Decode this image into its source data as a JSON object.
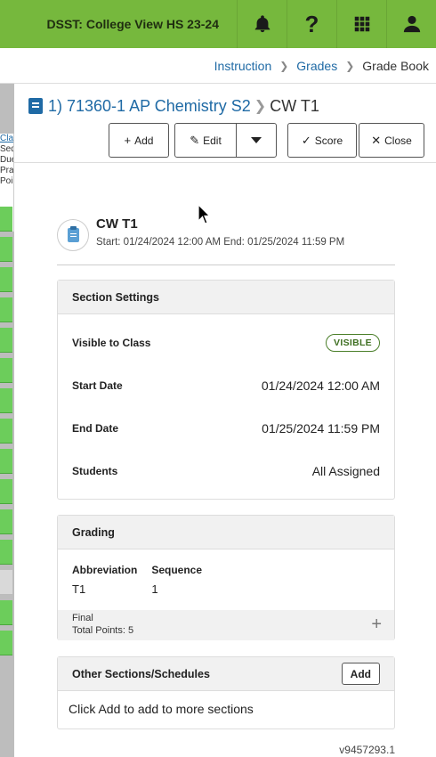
{
  "header": {
    "school": "DSST: College View HS 23-24",
    "icons": [
      "bell-icon",
      "help-icon",
      "apps-grid-icon",
      "user-icon"
    ],
    "help_glyph": "?",
    "accent_color": "#76b83d"
  },
  "breadcrumb": {
    "items": [
      "Instruction",
      "Grades",
      "Grade Book"
    ]
  },
  "grid_strip": {
    "header_lines": [
      "Clas",
      "Seq",
      "Due",
      "Prac",
      "Poin"
    ]
  },
  "title": {
    "course": "1) 71360-1 AP Chemistry S2",
    "section": "CW T1"
  },
  "toolbar": {
    "add_label": "Add",
    "edit_label": "Edit",
    "score_label": "Score",
    "close_label": "Close"
  },
  "event": {
    "name": "CW T1",
    "dates": "Start: 01/24/2024 12:00 AM   End: 01/25/2024 11:59 PM"
  },
  "section_settings": {
    "title": "Section Settings",
    "rows": [
      {
        "label": "Visible to Class",
        "value": "VISIBLE"
      },
      {
        "label": "Start Date",
        "value": "01/24/2024 12:00 AM"
      },
      {
        "label": "End Date",
        "value": "01/25/2024 11:59 PM"
      },
      {
        "label": "Students",
        "value": "All Assigned"
      }
    ]
  },
  "grading": {
    "title": "Grading",
    "abbreviation_label": "Abbreviation",
    "abbreviation_value": "T1",
    "sequence_label": "Sequence",
    "sequence_value": "1",
    "final_label": "Final",
    "total_points": "Total Points: 5"
  },
  "other_sections": {
    "title": "Other Sections/Schedules",
    "add_label": "Add",
    "body": "Click Add to add to more sections"
  },
  "version": "v9457293.1"
}
